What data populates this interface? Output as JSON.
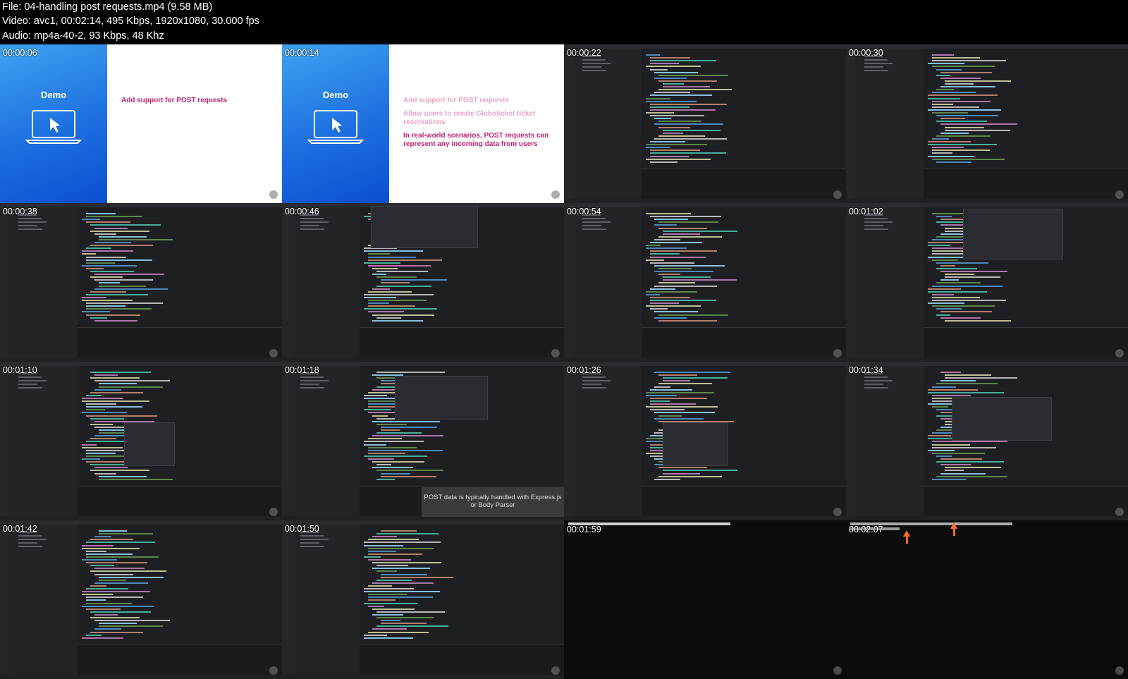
{
  "header": {
    "file": "File: 04-handling post requests.mp4 (9.58 MB)",
    "video": "Video: avc1, 00:02:14, 495 Kbps, 1920x1080, 30.000 fps",
    "audio": "Audio: mp4a-40-2, 93 Kbps, 48 Khz"
  },
  "slides": [
    {
      "timestamp": "00:00:06",
      "demo_label": "Demo",
      "lines": [
        "Add support for POST requests"
      ]
    },
    {
      "timestamp": "00:00:14",
      "demo_label": "Demo",
      "lines": [
        "Add support for POST requests",
        "Allow users to create Globoticket ticket reservations",
        "In real-world scenarios, POST requests can represent any incoming data from users"
      ]
    }
  ],
  "editor_timestamps": [
    "00:00:22",
    "00:00:30",
    "00:00:38",
    "00:00:46",
    "00:00:54",
    "00:01:02",
    "00:01:10",
    "00:01:18",
    "00:01:26",
    "00:01:34",
    "00:01:42",
    "00:01:50"
  ],
  "terminal_timestamps": [
    "00:01:59",
    "00:02:07"
  ],
  "caption": "POST data is typically handled with Express.js or Body Parser",
  "colors": {
    "slide_accent": "#c3236c",
    "slide_faded": "#e8a4c3",
    "arrow": "#ff6a2c",
    "editor_bg": "#1e1f22"
  }
}
